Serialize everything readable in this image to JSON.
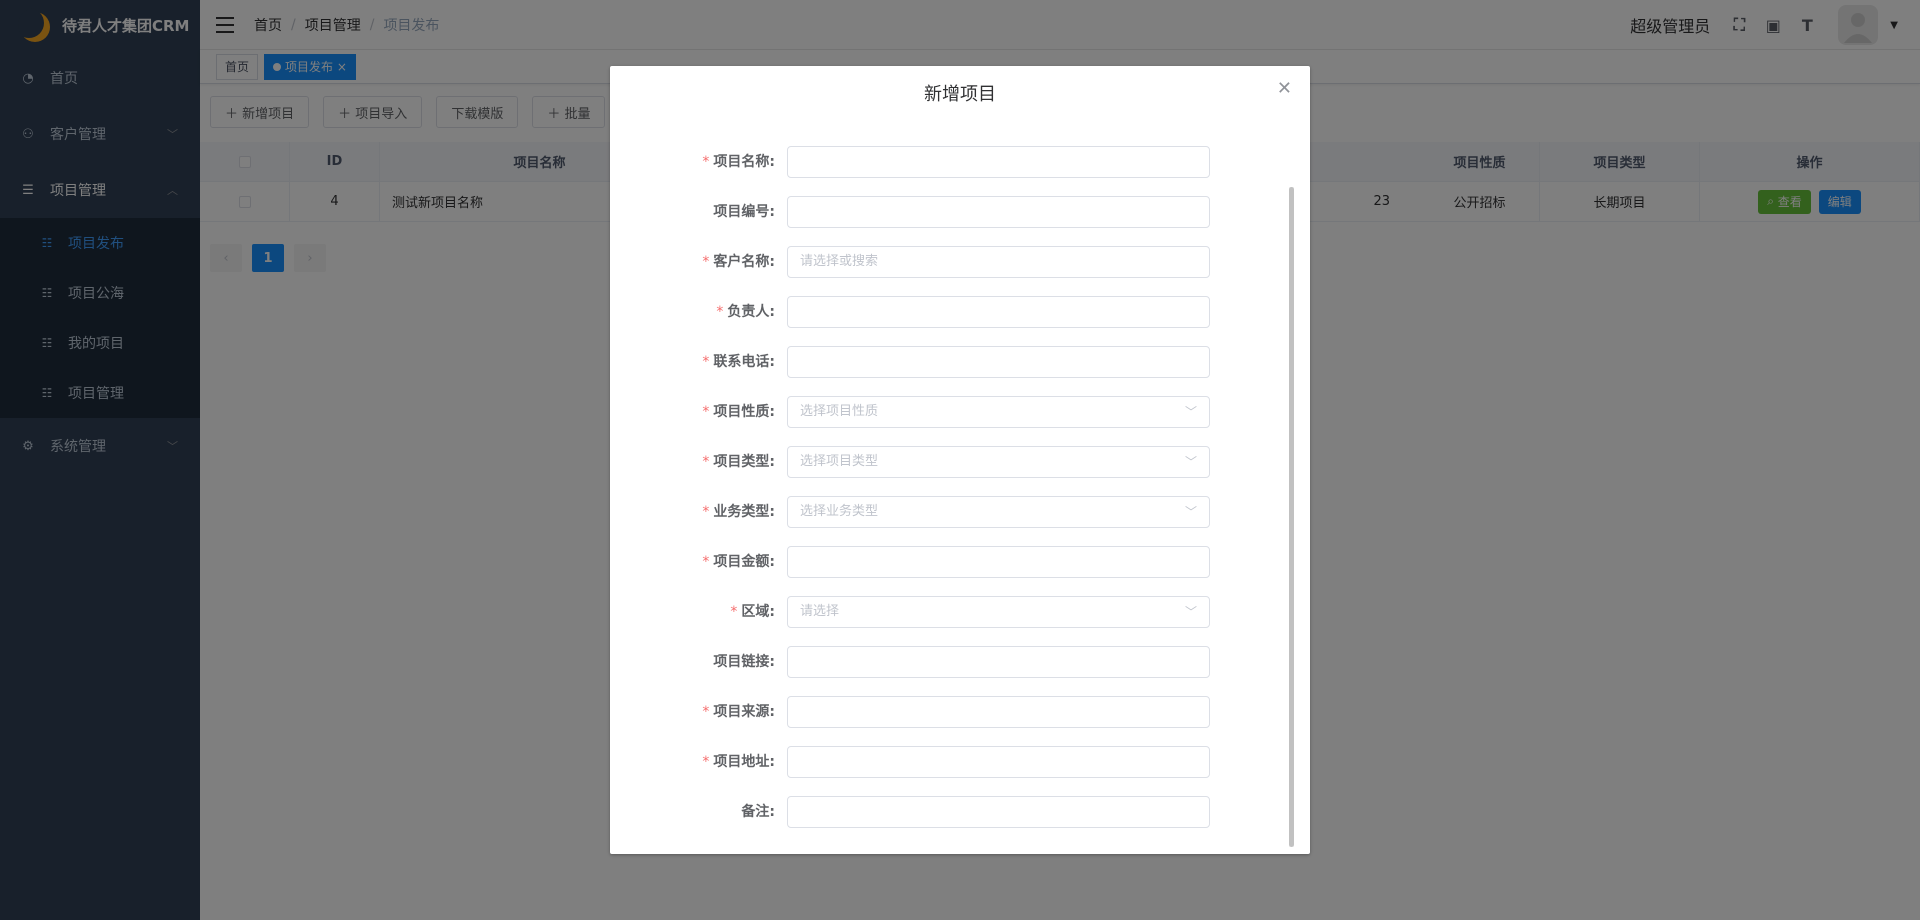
{
  "app": {
    "title": "待君人才集团CRM"
  },
  "sidebar": {
    "items": [
      {
        "label": "首页",
        "icon": "dashboard-icon"
      },
      {
        "label": "客户管理",
        "icon": "users-icon"
      },
      {
        "label": "项目管理",
        "icon": "list-icon"
      },
      {
        "label": "系统管理",
        "icon": "settings-icon"
      }
    ],
    "submenu": [
      {
        "label": "项目发布",
        "active": true
      },
      {
        "label": "项目公海"
      },
      {
        "label": "我的项目"
      },
      {
        "label": "项目管理"
      }
    ]
  },
  "breadcrumb": {
    "items": [
      "首页",
      "项目管理",
      "项目发布"
    ]
  },
  "header": {
    "user": "超级管理员"
  },
  "tags": {
    "home": "首页",
    "active": "项目发布"
  },
  "toolbar": {
    "add": "新增项目",
    "import": "项目导入",
    "template": "下载模版",
    "batch": "批量"
  },
  "table": {
    "headers": {
      "id": "ID",
      "name": "项目名称",
      "nature": "项目性质",
      "type": "项目类型",
      "ops": "操作"
    },
    "row": {
      "id": "4",
      "name": "测试新项目名称",
      "partial": "23",
      "nature": "公开招标",
      "type": "长期项目",
      "view": "查看",
      "edit": "编辑"
    }
  },
  "pager": {
    "current": "1"
  },
  "dialog": {
    "title": "新增项目",
    "fields": [
      {
        "label": "项目名称:",
        "required": true,
        "placeholder": ""
      },
      {
        "label": "项目编号:",
        "required": false,
        "placeholder": ""
      },
      {
        "label": "客户名称:",
        "required": true,
        "placeholder": "请选择或搜索"
      },
      {
        "label": "负责人:",
        "required": true,
        "placeholder": ""
      },
      {
        "label": "联系电话:",
        "required": true,
        "placeholder": ""
      },
      {
        "label": "项目性质:",
        "required": true,
        "placeholder": "选择项目性质",
        "select": true
      },
      {
        "label": "项目类型:",
        "required": true,
        "placeholder": "选择项目类型",
        "select": true
      },
      {
        "label": "业务类型:",
        "required": true,
        "placeholder": "选择业务类型",
        "select": true
      },
      {
        "label": "项目金额:",
        "required": true,
        "placeholder": ""
      },
      {
        "label": "区域:",
        "required": true,
        "placeholder": "请选择",
        "select": true
      },
      {
        "label": "项目链接:",
        "required": false,
        "placeholder": ""
      },
      {
        "label": "项目来源:",
        "required": true,
        "placeholder": ""
      },
      {
        "label": "项目地址:",
        "required": true,
        "placeholder": ""
      },
      {
        "label": "备注:",
        "required": false,
        "placeholder": ""
      }
    ]
  }
}
